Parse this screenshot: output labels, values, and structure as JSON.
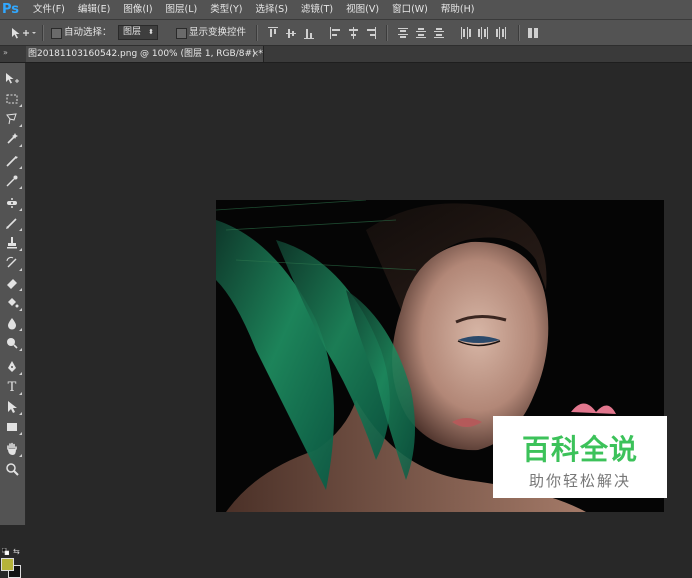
{
  "app": {
    "logo": "Ps"
  },
  "menu": [
    "文件(F)",
    "编辑(E)",
    "图像(I)",
    "图层(L)",
    "类型(Y)",
    "选择(S)",
    "滤镜(T)",
    "视图(V)",
    "窗口(W)",
    "帮助(H)"
  ],
  "options": {
    "auto_select_label": "自动选择：",
    "auto_select_value": "图层",
    "show_transform_label": "显示变换控件"
  },
  "document": {
    "tab_title": "图20181103160542.png @ 100% (图层 1, RGB/8#) *",
    "close_glyph": "×"
  },
  "toolbox": {
    "collapse_glyph": "»",
    "tools": [
      "move-tool",
      "marquee-tool",
      "lasso-tool",
      "quick-select-tool",
      "crop-tool",
      "eyedropper-tool",
      "healing-brush-tool",
      "brush-tool",
      "clone-stamp-tool",
      "history-brush-tool",
      "eraser-tool",
      "gradient-tool",
      "blur-tool",
      "dodge-tool",
      "pen-tool",
      "type-tool",
      "path-select-tool",
      "rectangle-tool",
      "hand-tool",
      "zoom-tool"
    ],
    "foreground_color": "#b5b33a",
    "background_color": "#111111"
  },
  "watermark": {
    "title": "百科全说",
    "subtitle": "助你轻松解决"
  }
}
